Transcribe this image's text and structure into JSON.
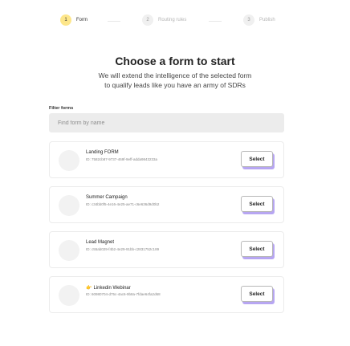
{
  "stepper": {
    "steps": [
      {
        "number": "1",
        "label": "Form",
        "state": "active"
      },
      {
        "number": "2",
        "label": "Routing rules",
        "state": "inactive"
      },
      {
        "number": "3",
        "label": "Publish",
        "state": "inactive"
      }
    ]
  },
  "header": {
    "title": "Choose a form to start",
    "subtitle_line1": "We will extend the intelligence of the selected form",
    "subtitle_line2": "to qualify leads like you have an army of SDRs"
  },
  "filter": {
    "label": "Filter forms",
    "placeholder": "Find form by name"
  },
  "forms": [
    {
      "name": "Landing FORM",
      "emoji": "",
      "id_text": "ID: 7582cb87-9737-469f-9eff-adda9843233a",
      "select_label": "Select"
    },
    {
      "name": "Summer Campaign",
      "emoji": "",
      "id_text": "ID: c34bb0f5-4e16-4e25-ae71-c6e636d9d0b2",
      "select_label": "Select"
    },
    {
      "name": "Lead Magnet",
      "emoji": "",
      "id_text": "ID: c55ab029-f4b2-4e29-91bb-c2831752c189",
      "select_label": "Select"
    },
    {
      "name": "Linkedin Webinar",
      "emoji": "👉",
      "id_text": "ID: 60980704-d75c-4ac6-9b8a-7fdae64fa2d68",
      "select_label": "Select"
    }
  ],
  "colors": {
    "active_step": "#fde68a",
    "button_shadow": "#b7a6f2",
    "search_bg": "#ececec"
  }
}
